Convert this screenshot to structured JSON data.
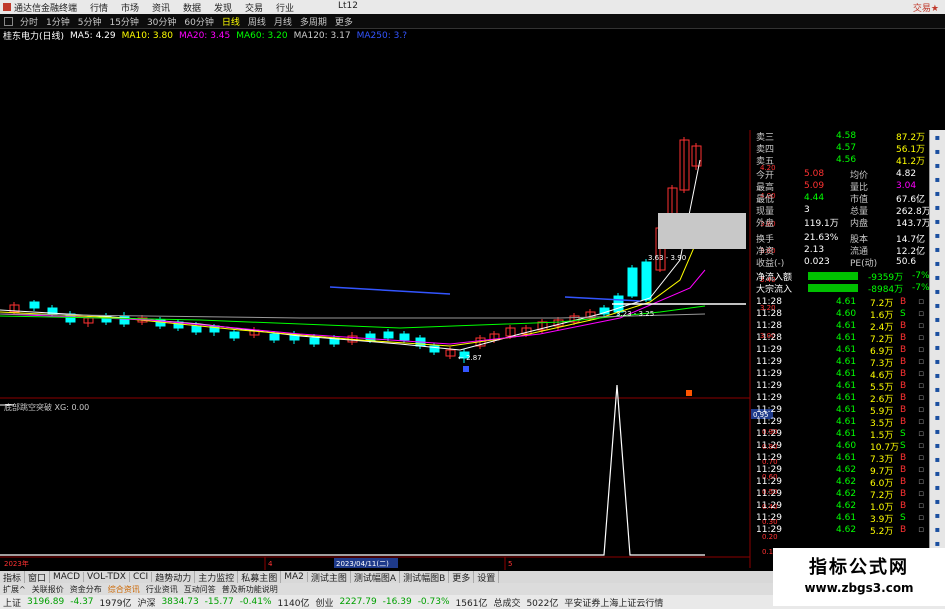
{
  "titlebar": {
    "app_name": "通达信金融终端",
    "menu": [
      "行情",
      "市场",
      "资讯",
      "数据",
      "发现",
      "交易",
      "行业",
      "",
      "Lt12"
    ],
    "right_label": "交易★"
  },
  "periods": [
    "分时",
    "1分钟",
    "5分钟",
    "15分钟",
    "30分钟",
    "60分钟",
    "日线",
    "周线",
    "月线",
    "多周期",
    "更多"
  ],
  "active_period": "日线",
  "indicators": {
    "stock": "桂东电力(日线)",
    "ma": [
      {
        "label": "MA5: 4.29",
        "color": "#ffffff"
      },
      {
        "label": "MA10: 3.80",
        "color": "#ffff00"
      },
      {
        "label": "MA20: 3.45",
        "color": "#ff00ff"
      },
      {
        "label": "MA60: 3.20",
        "color": "#00ff00"
      },
      {
        "label": "MA120: 3.17",
        "color": "#cccccc"
      },
      {
        "label": "MA250: 3.?",
        "color": "#3355ff"
      }
    ]
  },
  "sub_chart": {
    "title": "底部跳空突破 XG: 0.00",
    "scale_labels": [
      "0.95",
      "0.90",
      "0.80",
      "0.70",
      "0.60",
      "0.50",
      "0.40",
      "0.30",
      "0.20",
      "0.10"
    ]
  },
  "main_chart": {
    "price_labels": [
      "4.20",
      "4.00",
      "3.80",
      "3.60",
      "3.40",
      "3.20",
      "3.00"
    ],
    "annotations": [
      "3.63 - 3.90",
      "3.23 - 3.25",
      "2.87"
    ]
  },
  "time_axis": [
    "2023年",
    "4",
    "2023/04/11(二)",
    "5"
  ],
  "colors": {
    "up": "#ff3232",
    "down": "#00ffff",
    "grid": "#8b0000",
    "panel_green": "#00ff00",
    "panel_red": "#ff3232"
  },
  "order_book": [
    {
      "label": "卖三",
      "price": "4.58",
      "vol": "87.2万"
    },
    {
      "label": "卖四",
      "price": "4.57",
      "vol": "56.1万"
    },
    {
      "label": "卖五",
      "price": "4.56",
      "vol": "41.2万"
    }
  ],
  "stats": [
    {
      "l1": "今开",
      "v1": "5.08",
      "l2": "均价",
      "v2": "4.82"
    },
    {
      "l1": "最高",
      "v1": "5.09",
      "l2": "量比",
      "v2": "3.04"
    },
    {
      "l1": "最低",
      "v1": "4.44",
      "l2": "市值",
      "v2": "67.6亿"
    },
    {
      "l1": "现量",
      "v1": "3",
      "l2": "总量",
      "v2": "262.8万"
    },
    {
      "l1": "外盘",
      "v1": "119.1万",
      "l2": "内盘",
      "v2": "143.7万"
    },
    {
      "l1": "换手",
      "v1": "21.63%",
      "l2": "股本",
      "v2": "14.7亿"
    },
    {
      "l1": "净资",
      "v1": "2.13",
      "l2": "流通",
      "v2": "12.2亿"
    },
    {
      "l1": "收益(-)",
      "v1": "0.023",
      "l2": "PE(动)",
      "v2": "50.6"
    }
  ],
  "flows": [
    {
      "label": "净流入额",
      "value": "-9359万",
      "pct": "-7%"
    },
    {
      "label": "大宗流入",
      "value": "-8984万",
      "pct": "-7%"
    }
  ],
  "ticks": [
    {
      "time": "11:28",
      "price": "4.61",
      "vol": "7.2万",
      "side": "B"
    },
    {
      "time": "11:28",
      "price": "4.60",
      "vol": "1.6万",
      "side": "S"
    },
    {
      "time": "11:28",
      "price": "4.61",
      "vol": "2.4万",
      "side": "B"
    },
    {
      "time": "11:28",
      "price": "4.61",
      "vol": "7.2万",
      "side": "B"
    },
    {
      "time": "11:29",
      "price": "4.61",
      "vol": "6.9万",
      "side": "B"
    },
    {
      "time": "11:29",
      "price": "4.61",
      "vol": "7.3万",
      "side": "B"
    },
    {
      "time": "11:29",
      "price": "4.61",
      "vol": "4.6万",
      "side": "B"
    },
    {
      "time": "11:29",
      "price": "4.61",
      "vol": "5.5万",
      "side": "B"
    },
    {
      "time": "11:29",
      "price": "4.61",
      "vol": "2.6万",
      "side": "B"
    },
    {
      "time": "11:29",
      "price": "4.61",
      "vol": "5.9万",
      "side": "B"
    },
    {
      "time": "11:29",
      "price": "4.61",
      "vol": "3.5万",
      "side": "B"
    },
    {
      "time": "11:29",
      "price": "4.61",
      "vol": "1.5万",
      "side": "S"
    },
    {
      "time": "11:29",
      "price": "4.60",
      "vol": "10.7万",
      "side": "S"
    },
    {
      "time": "11:29",
      "price": "4.61",
      "vol": "7.3万",
      "side": "B"
    },
    {
      "time": "11:29",
      "price": "4.62",
      "vol": "9.7万",
      "side": "B"
    },
    {
      "time": "11:29",
      "price": "4.62",
      "vol": "6.0万",
      "side": "B"
    },
    {
      "time": "11:29",
      "price": "4.62",
      "vol": "7.2万",
      "side": "B"
    },
    {
      "time": "11:29",
      "price": "4.62",
      "vol": "1.0万",
      "side": "B"
    },
    {
      "time": "11:29",
      "price": "4.61",
      "vol": "3.9万",
      "side": "S"
    },
    {
      "time": "11:29",
      "price": "4.62",
      "vol": "5.2万",
      "side": "B"
    }
  ],
  "bottom_tabs": [
    "指标",
    "窗口",
    "MACD",
    "VOL-TDX",
    "CCI",
    "趋势动力",
    "主力监控",
    "私募主图",
    "MA2",
    "测试主图",
    "测试幅图A",
    "测试幅图B",
    "更多",
    "设置"
  ],
  "feature_tabs": [
    "扩展^",
    "关联报价",
    "资金分布",
    "综合资讯",
    "行业资讯",
    "互动问答",
    "普及新功能说明"
  ],
  "feature_highlight": "综合资讯",
  "status": {
    "sh_label": "上证",
    "sh_val": "3196.89",
    "sh_chg": "-4.37",
    "sh_amt": "1979亿",
    "sz_label": "沪深",
    "sz_val": "3834.73",
    "sz_chg": "-15.77",
    "sz_pct": "-0.41%",
    "sz_amt": "1140亿",
    "cy_label": "创业",
    "cy_val": "2227.79",
    "cy_chg": "-16.39",
    "cy_pct": "-0.73%",
    "cy_amt": "1561亿",
    "total_label": "总成交",
    "total_val": "5022亿",
    "broker": "平安证券上海上证云行情"
  },
  "watermark": {
    "line1": "指标公式网",
    "line2": "www.zbgs3.com"
  }
}
